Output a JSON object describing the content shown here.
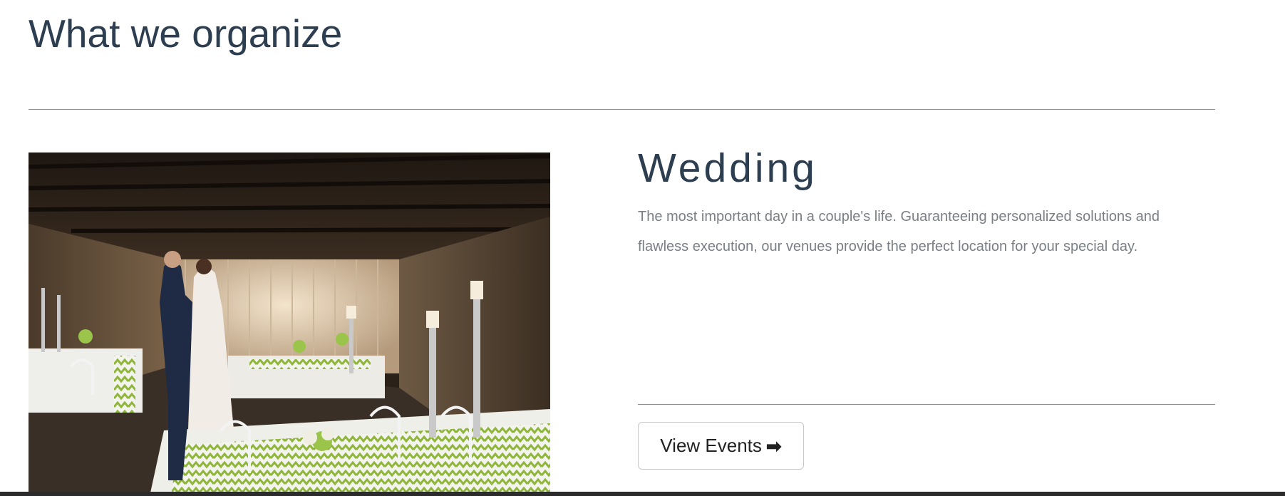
{
  "section": {
    "title": "What we organize"
  },
  "event": {
    "title": "Wedding",
    "description": "The most important day in a couple's life. Guaranteeing personalized solutions and flawless execution, our venues provide the perfect location for your special day.",
    "button_label": "View Events",
    "button_icon": "arrow-right-icon"
  }
}
